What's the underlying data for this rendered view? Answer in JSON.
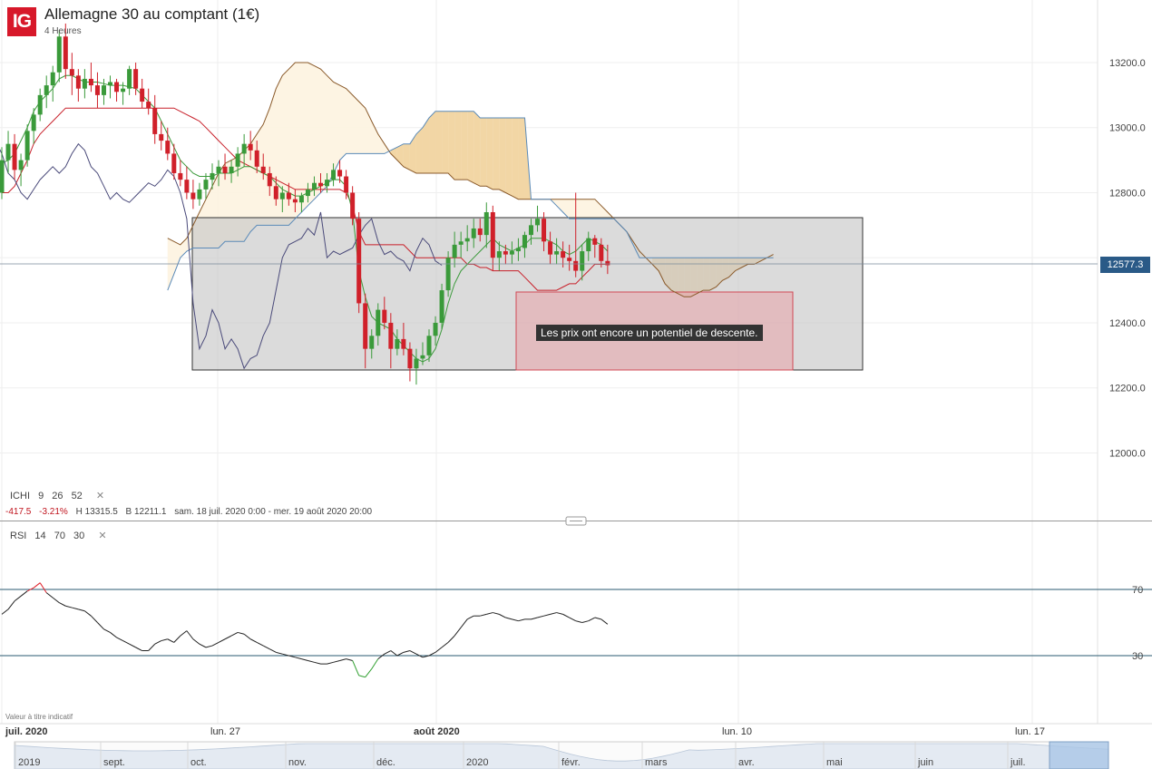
{
  "header": {
    "logo": "IG",
    "title": "Allemagne 30 au comptant (1€)",
    "timeframe": "4 Heures"
  },
  "indicators": {
    "ichimoku": {
      "name": "ICHI",
      "params": [
        "9",
        "26",
        "52"
      ]
    },
    "ohlc": {
      "change": "-417.5",
      "change_pct": "-3.21%",
      "high": "H 13315.5",
      "low": "B 12211.1",
      "range": "sam. 18 juil. 2020 0:00 - mer. 19 août 2020 20:00"
    },
    "rsi": {
      "name": "RSI",
      "params": [
        "14",
        "70",
        "30"
      ]
    },
    "close_icon": "close-icon"
  },
  "price": {
    "last": "12577.3",
    "y_ticks": [
      {
        "value": 13200,
        "label": "13200.0"
      },
      {
        "value": 13000,
        "label": "13000.0"
      },
      {
        "value": 12800,
        "label": "12800.0"
      },
      {
        "value": 12400,
        "label": "12400.0"
      },
      {
        "value": 12200,
        "label": "12200.0"
      },
      {
        "value": 12000,
        "label": "12000.0"
      }
    ]
  },
  "rsi_levels": [
    {
      "value": 70,
      "label": "70"
    },
    {
      "value": 30,
      "label": "30"
    }
  ],
  "annotation": "Les prix ont encore un potentiel de descente.",
  "disclaimer": "Valeur à titre indicatif",
  "x_labels": [
    "juil. 2020",
    "lun. 27",
    "août 2020",
    "lun. 10",
    "lun. 17"
  ],
  "nav_labels": [
    "2019",
    "sept.",
    "oct.",
    "nov.",
    "déc.",
    "2020",
    "févr.",
    "mars",
    "avr.",
    "mai",
    "juin",
    "juil."
  ],
  "colors": {
    "up": "#3a9a3a",
    "down": "#d0202a",
    "tenkan": "#3c9a3c",
    "kijun": "#c8202a",
    "chikou": "#4a4a7a",
    "span_a": "#8a5a2a",
    "span_b": "#5a8ab8",
    "cloud_light": "#fdf3e0",
    "cloud_dark": "#f0d09a",
    "rsi": "#222222",
    "rsi_over": "#e0202a",
    "rsi_under": "#30a030",
    "level": "#2a5a70"
  },
  "chart_data": {
    "type": "candlestick",
    "x": [
      "juil. 2020",
      "lun. 27",
      "août 2020",
      "lun. 10",
      "lun. 17"
    ],
    "ohlc": [
      [
        12800,
        12940,
        12780,
        12900
      ],
      [
        12900,
        12990,
        12860,
        12950
      ],
      [
        12950,
        12980,
        12840,
        12870
      ],
      [
        12870,
        12920,
        12820,
        12900
      ],
      [
        12900,
        13010,
        12880,
        12990
      ],
      [
        12990,
        13060,
        12950,
        13040
      ],
      [
        13040,
        13120,
        13020,
        13100
      ],
      [
        13100,
        13160,
        13060,
        13130
      ],
      [
        13130,
        13190,
        13080,
        13170
      ],
      [
        13170,
        13300,
        13140,
        13280
      ],
      [
        13280,
        13320,
        13150,
        13180
      ],
      [
        13180,
        13230,
        13100,
        13160
      ],
      [
        13160,
        13180,
        13080,
        13120
      ],
      [
        13120,
        13180,
        13090,
        13150
      ],
      [
        13150,
        13200,
        13110,
        13130
      ],
      [
        13130,
        13170,
        13060,
        13100
      ],
      [
        13100,
        13150,
        13070,
        13130
      ],
      [
        13130,
        13160,
        13090,
        13140
      ],
      [
        13140,
        13150,
        13080,
        13110
      ],
      [
        13110,
        13140,
        13070,
        13120
      ],
      [
        13120,
        13190,
        13100,
        13180
      ],
      [
        13180,
        13200,
        13100,
        13120
      ],
      [
        13120,
        13150,
        13060,
        13080
      ],
      [
        13080,
        13120,
        13040,
        13060
      ],
      [
        13060,
        13100,
        12950,
        12980
      ],
      [
        12980,
        13020,
        12930,
        12960
      ],
      [
        12960,
        13000,
        12900,
        12920
      ],
      [
        12920,
        12950,
        12840,
        12860
      ],
      [
        12860,
        12900,
        12820,
        12840
      ],
      [
        12840,
        12880,
        12780,
        12800
      ],
      [
        12800,
        12840,
        12750,
        12780
      ],
      [
        12780,
        12830,
        12760,
        12810
      ],
      [
        12810,
        12860,
        12780,
        12840
      ],
      [
        12840,
        12890,
        12810,
        12860
      ],
      [
        12860,
        12900,
        12820,
        12880
      ],
      [
        12880,
        12920,
        12840,
        12860
      ],
      [
        12860,
        12900,
        12830,
        12880
      ],
      [
        12880,
        12940,
        12850,
        12920
      ],
      [
        12920,
        12980,
        12880,
        12950
      ],
      [
        12950,
        12990,
        12900,
        12930
      ],
      [
        12930,
        12960,
        12860,
        12880
      ],
      [
        12880,
        12920,
        12840,
        12860
      ],
      [
        12860,
        12880,
        12790,
        12820
      ],
      [
        12820,
        12850,
        12760,
        12780
      ],
      [
        12780,
        12820,
        12740,
        12800
      ],
      [
        12800,
        12830,
        12760,
        12780
      ],
      [
        12780,
        12810,
        12740,
        12770
      ],
      [
        12770,
        12800,
        12740,
        12790
      ],
      [
        12790,
        12830,
        12770,
        12810
      ],
      [
        12810,
        12850,
        12790,
        12830
      ],
      [
        12830,
        12860,
        12800,
        12820
      ],
      [
        12820,
        12860,
        12800,
        12840
      ],
      [
        12840,
        12890,
        12820,
        12870
      ],
      [
        12870,
        12900,
        12830,
        12850
      ],
      [
        12850,
        12870,
        12780,
        12800
      ],
      [
        12800,
        12820,
        12700,
        12720
      ],
      [
        12720,
        12740,
        12430,
        12460
      ],
      [
        12460,
        12490,
        12260,
        12320
      ],
      [
        12320,
        12380,
        12290,
        12360
      ],
      [
        12360,
        12460,
        12330,
        12440
      ],
      [
        12440,
        12480,
        12380,
        12400
      ],
      [
        12400,
        12430,
        12260,
        12320
      ],
      [
        12320,
        12380,
        12300,
        12350
      ],
      [
        12350,
        12400,
        12300,
        12320
      ],
      [
        12320,
        12340,
        12220,
        12260
      ],
      [
        12260,
        12320,
        12210,
        12290
      ],
      [
        12290,
        12340,
        12270,
        12300
      ],
      [
        12300,
        12380,
        12280,
        12360
      ],
      [
        12360,
        12420,
        12330,
        12400
      ],
      [
        12400,
        12520,
        12380,
        12500
      ],
      [
        12500,
        12620,
        12480,
        12600
      ],
      [
        12600,
        12680,
        12570,
        12640
      ],
      [
        12640,
        12680,
        12600,
        12650
      ],
      [
        12650,
        12700,
        12620,
        12660
      ],
      [
        12660,
        12720,
        12630,
        12690
      ],
      [
        12690,
        12720,
        12650,
        12670
      ],
      [
        12670,
        12770,
        12630,
        12740
      ],
      [
        12740,
        12760,
        12560,
        12600
      ],
      [
        12600,
        12650,
        12560,
        12620
      ],
      [
        12620,
        12640,
        12580,
        12610
      ],
      [
        12610,
        12650,
        12580,
        12620
      ],
      [
        12620,
        12660,
        12590,
        12630
      ],
      [
        12630,
        12680,
        12600,
        12670
      ],
      [
        12670,
        12720,
        12640,
        12700
      ],
      [
        12700,
        12760,
        12680,
        12720
      ],
      [
        12720,
        12740,
        12620,
        12650
      ],
      [
        12650,
        12680,
        12580,
        12610
      ],
      [
        12610,
        12660,
        12580,
        12620
      ],
      [
        12620,
        12650,
        12570,
        12600
      ],
      [
        12600,
        12640,
        12560,
        12590
      ],
      [
        12590,
        12800,
        12540,
        12560
      ],
      [
        12560,
        12640,
        12530,
        12620
      ],
      [
        12620,
        12680,
        12590,
        12660
      ],
      [
        12660,
        12670,
        12600,
        12640
      ],
      [
        12640,
        12660,
        12570,
        12590
      ],
      [
        12590,
        12640,
        12550,
        12577
      ]
    ],
    "tenkan": [
      12890,
      12900,
      12920,
      12960,
      13000,
      13050,
      13080,
      13100,
      13120,
      13150,
      13160,
      13160,
      13150,
      13140,
      13140,
      13140,
      13135,
      13130,
      13130,
      13130,
      13125,
      13120,
      13100,
      13080,
      13060,
      13020,
      12980,
      12940,
      12900,
      12880,
      12860,
      12850,
      12850,
      12850,
      12860,
      12860,
      12860,
      12870,
      12880,
      12880,
      12870,
      12860,
      12850,
      12830,
      12810,
      12800,
      12790,
      12790,
      12800,
      12810,
      12820,
      12830,
      12840,
      12840,
      12820,
      12740,
      12560,
      12480,
      12420,
      12400,
      12390,
      12380,
      12350,
      12330,
      12310,
      12290,
      12280,
      12290,
      12320,
      12380,
      12460,
      12520,
      12560,
      12580,
      12600,
      12620,
      12640,
      12660,
      12640,
      12630,
      12620,
      12630,
      12640,
      12660,
      12660,
      12660,
      12650,
      12640,
      12620,
      12610,
      12620,
      12640,
      12660,
      12650,
      12640,
      12620
    ],
    "kijun": [
      12800,
      12800,
      12820,
      12860,
      12900,
      12950,
      12980,
      13000,
      13020,
      13040,
      13060,
      13060,
      13060,
      13060,
      13060,
      13060,
      13060,
      13060,
      13060,
      13060,
      13060,
      13060,
      13060,
      13060,
      13060,
      13060,
      13060,
      13060,
      13050,
      13040,
      13030,
      13020,
      13000,
      12980,
      12960,
      12940,
      12920,
      12900,
      12890,
      12880,
      12870,
      12860,
      12850,
      12840,
      12830,
      12820,
      12810,
      12810,
      12810,
      12810,
      12810,
      12810,
      12810,
      12810,
      12800,
      12760,
      12680,
      12640,
      12640,
      12640,
      12640,
      12640,
      12640,
      12640,
      12620,
      12600,
      12600,
      12600,
      12600,
      12600,
      12600,
      12600,
      12600,
      12580,
      12580,
      12570,
      12570,
      12560,
      12560,
      12560,
      12560,
      12560,
      12540,
      12520,
      12500,
      12500,
      12500,
      12500,
      12510,
      12520,
      12520,
      12540,
      12560,
      12580,
      12580,
      12580
    ],
    "span_a": [
      12660,
      12650,
      12640,
      12660,
      12700,
      12740,
      12780,
      12820,
      12860,
      12890,
      12900,
      12910,
      12930,
      12950,
      12980,
      13010,
      13060,
      13120,
      13160,
      13180,
      13200,
      13200,
      13200,
      13190,
      13180,
      13160,
      13140,
      13130,
      13120,
      13100,
      13080,
      13060,
      13020,
      12980,
      12950,
      12920,
      12900,
      12880,
      12870,
      12860,
      12860,
      12860,
      12860,
      12860,
      12860,
      12840,
      12840,
      12840,
      12830,
      12820,
      12820,
      12810,
      12810,
      12800,
      12790,
      12780,
      12780,
      12780,
      12780,
      12780,
      12780,
      12780,
      12780,
      12780,
      12780,
      12780,
      12780,
      12780,
      12760,
      12740,
      12720,
      12700,
      12680,
      12650,
      12620,
      12600,
      12580,
      12560,
      12520,
      12500,
      12490,
      12480,
      12480,
      12490,
      12500,
      12500,
      12510,
      12530,
      12540,
      12560,
      12570,
      12580,
      12580,
      12590,
      12600,
      12610
    ],
    "span_b": [
      12500,
      12550,
      12600,
      12620,
      12630,
      12630,
      12630,
      12630,
      12630,
      12650,
      12650,
      12650,
      12650,
      12680,
      12700,
      12700,
      12700,
      12700,
      12700,
      12700,
      12720,
      12740,
      12760,
      12780,
      12800,
      12820,
      12860,
      12900,
      12920,
      12920,
      12920,
      12920,
      12920,
      12920,
      12920,
      12930,
      12940,
      12950,
      12950,
      12980,
      13000,
      13030,
      13050,
      13050,
      13050,
      13050,
      13050,
      13050,
      13050,
      13030,
      13030,
      13030,
      13030,
      13030,
      13030,
      13030,
      13030,
      12780,
      12780,
      12780,
      12780,
      12760,
      12740,
      12720,
      12720,
      12720,
      12720,
      12720,
      12720,
      12720,
      12720,
      12700,
      12680,
      12640,
      12600,
      12600,
      12600,
      12600,
      12600,
      12600,
      12600,
      12600,
      12600,
      12600,
      12600,
      12600,
      12600,
      12600,
      12600,
      12600,
      12600,
      12600,
      12600,
      12600,
      12600,
      12600
    ],
    "rsi": [
      55,
      58,
      63,
      66,
      69,
      71,
      74,
      68,
      65,
      62,
      60,
      59,
      58,
      57,
      54,
      50,
      46,
      44,
      41,
      39,
      37,
      35,
      33,
      33,
      37,
      39,
      40,
      38,
      42,
      45,
      40,
      37,
      35,
      36,
      38,
      40,
      42,
      44,
      43,
      40,
      38,
      36,
      34,
      32,
      31,
      30,
      29,
      28,
      27,
      26,
      25,
      25,
      26,
      27,
      28,
      27,
      18,
      17,
      22,
      28,
      31,
      33,
      30,
      32,
      33,
      31,
      29,
      30,
      32,
      35,
      38,
      42,
      47,
      52,
      54,
      54,
      55,
      56,
      55,
      53,
      52,
      51,
      52,
      52,
      53,
      54,
      55,
      56,
      55,
      53,
      51,
      50,
      51,
      53,
      52,
      49
    ]
  }
}
